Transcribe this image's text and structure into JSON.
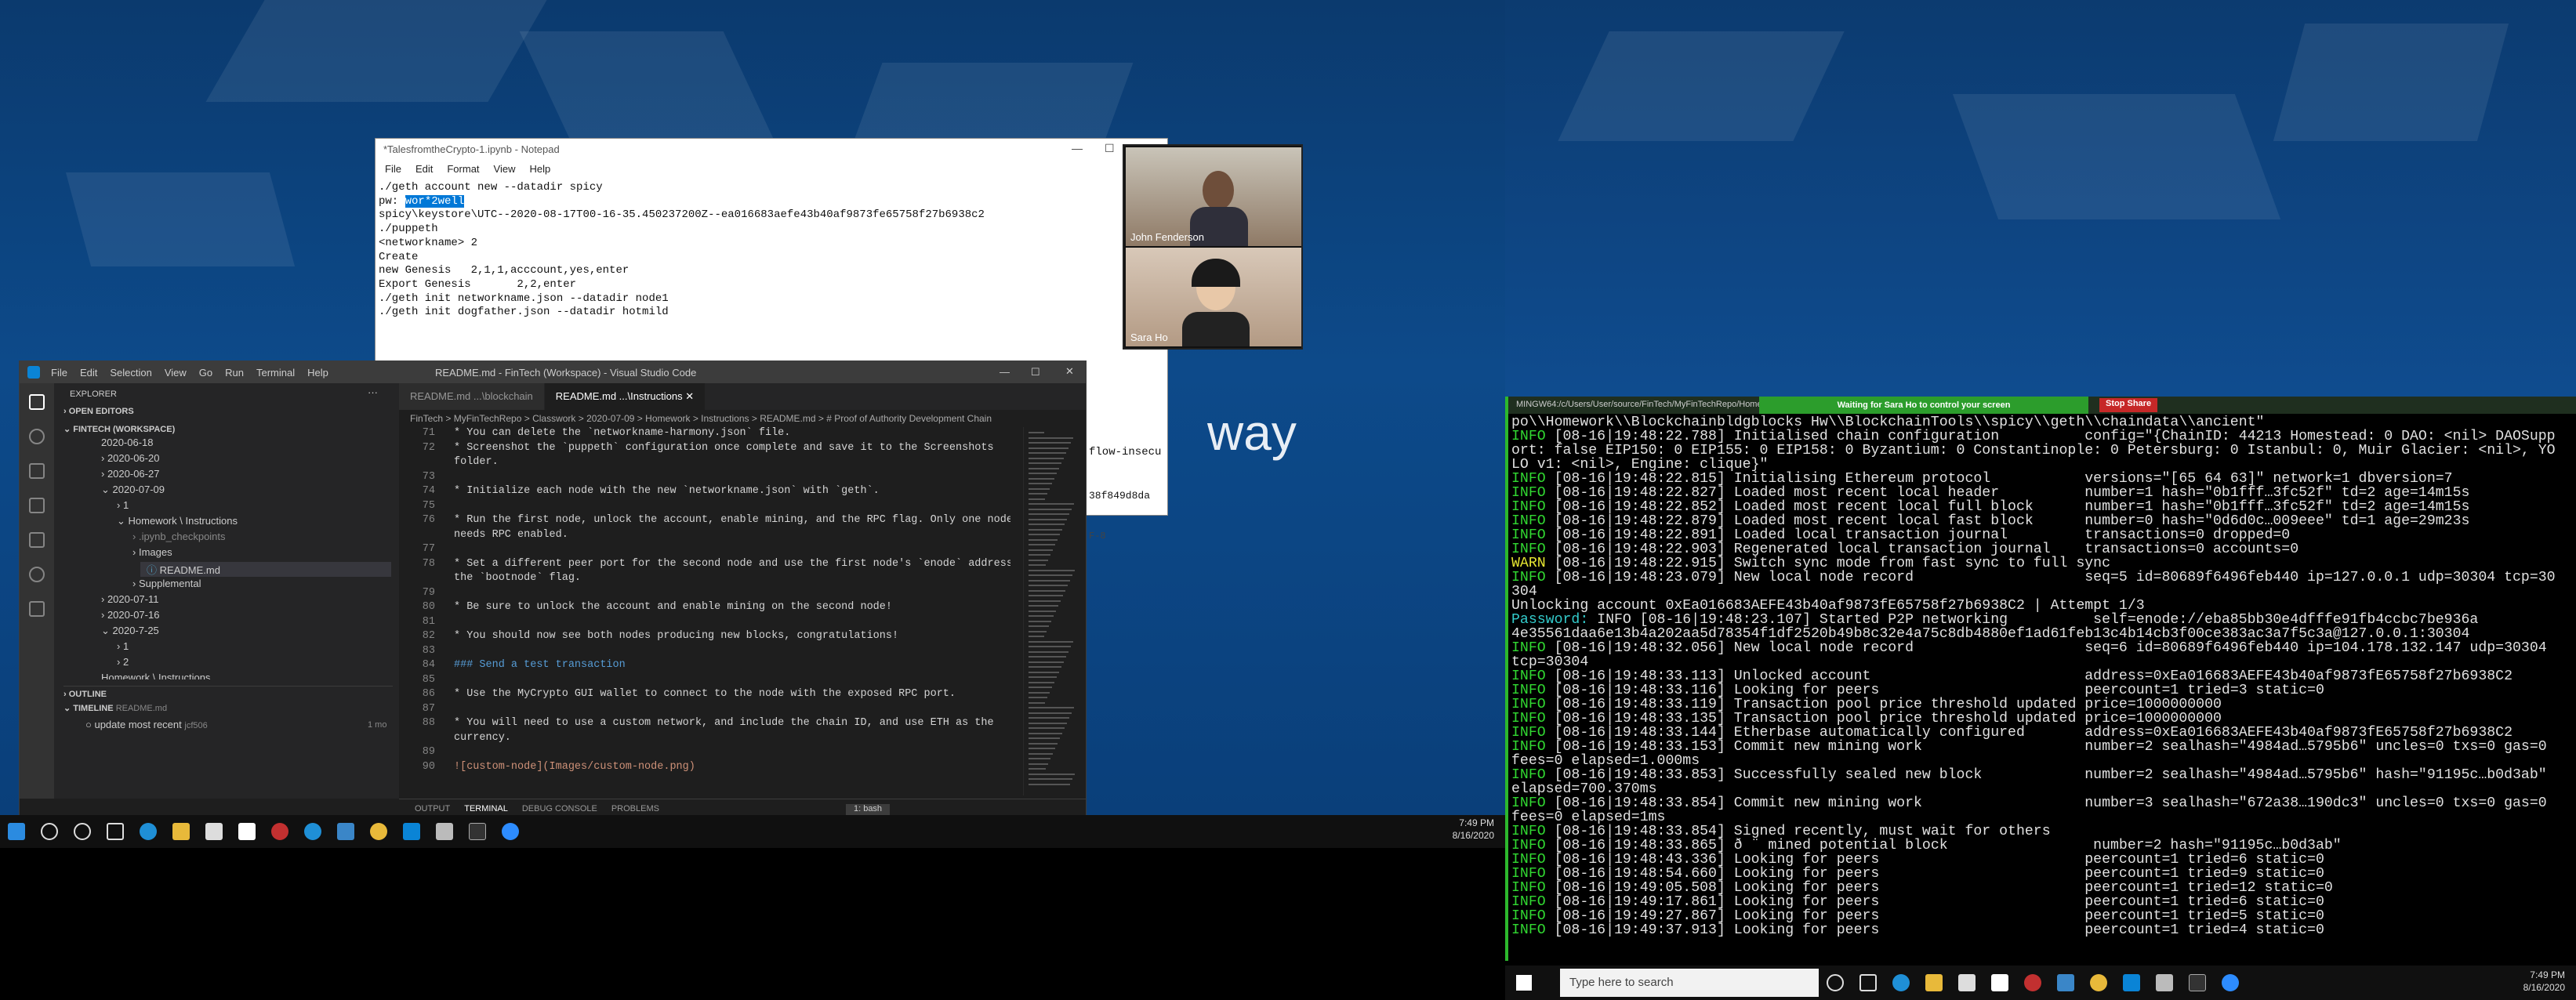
{
  "wallpaper_text": "way",
  "notepad": {
    "title": "*TalesfromtheCrypto-1.ipynb - Notepad",
    "menu": [
      "File",
      "Edit",
      "Format",
      "View",
      "Help"
    ],
    "lines": [
      "./geth account new --datadir spicy",
      "pw: ",
      "spicy\\keystore\\UTC--2020-08-17T00-16-35.450237200Z--ea016683aefe43b40af9873fe65758f27b6938c2",
      "./puppeth",
      "<networkname> 2",
      "Create",
      "new Genesis   2,1,1,acccount,yes,enter",
      "",
      "Export Genesis       2,2,enter",
      "",
      "./geth init networkname.json --datadir node1",
      "",
      "./geth init dogfather.json --datadir hotmild"
    ],
    "selected_pw": "wor*2well",
    "edge_text_1": "flow-insecu",
    "edge_text_2": "38f849d8da",
    "edge_text_3": "F-8"
  },
  "video": {
    "participant_1": "John Fenderson",
    "participant_2": "Sara Ho"
  },
  "vscode": {
    "title": "README.md - FinTech (Workspace) - Visual Studio Code",
    "menu": [
      "File",
      "Edit",
      "Selection",
      "View",
      "Go",
      "Run",
      "Terminal",
      "Help"
    ],
    "explorer_label": "EXPLORER",
    "open_editors": "OPEN EDITORS",
    "workspace": "FINTECH (WORKSPACE)",
    "tree": [
      "2020-06-18",
      "2020-06-20",
      "2020-06-27",
      "2020-07-09",
      "1",
      "Homework \\ Instructions",
      ".ipynb_checkpoints",
      "Images",
      "README.md",
      "Supplemental",
      "2020-07-11",
      "2020-07-16",
      "2020-7-25",
      "1",
      "2",
      "Homework \\ Instructions"
    ],
    "outline": "OUTLINE",
    "timeline": "TIMELINE",
    "timeline_file": "README.md",
    "timeline_item": "update most recent",
    "timeline_author": "jcf506",
    "timeline_age": "1 mo",
    "tabs": [
      "README.md ...\\blockchain",
      "README.md ...\\Instructions"
    ],
    "breadcrumb": "FinTech > MyFinTechRepo > Classwork > 2020-07-09 > Homework > Instructions > README.md > # Proof of Authority Development Chain",
    "lines": [
      {
        "n": "71",
        "t": "* You can delete the `networkname-harmony.json` file."
      },
      {
        "n": "72",
        "t": "* Screenshot the `puppeth` configuration once complete and save it to the Screenshots"
      },
      {
        "n": "",
        "t": "folder."
      },
      {
        "n": "73",
        "t": ""
      },
      {
        "n": "74",
        "t": "* Initialize each node with the new `networkname.json` with `geth`."
      },
      {
        "n": "75",
        "t": ""
      },
      {
        "n": "76",
        "t": "* Run the first node, unlock the account, enable mining, and the RPC flag. Only one node"
      },
      {
        "n": "",
        "t": "needs RPC enabled."
      },
      {
        "n": "77",
        "t": ""
      },
      {
        "n": "78",
        "t": "* Set a different peer port for the second node and use the first node's `enode` address as"
      },
      {
        "n": "",
        "t": "the `bootnode` flag."
      },
      {
        "n": "79",
        "t": ""
      },
      {
        "n": "80",
        "t": "* Be sure to unlock the account and enable mining on the second node!"
      },
      {
        "n": "81",
        "t": ""
      },
      {
        "n": "82",
        "t": "* You should now see both nodes producing new blocks, congratulations!"
      },
      {
        "n": "83",
        "t": ""
      },
      {
        "n": "84",
        "t": "### Send a test transaction"
      },
      {
        "n": "85",
        "t": ""
      },
      {
        "n": "86",
        "t": "* Use the MyCrypto GUI wallet to connect to the node with the exposed RPC port."
      },
      {
        "n": "87",
        "t": ""
      },
      {
        "n": "88",
        "t": "* You will need to use a custom network, and include the chain ID, and use ETH as the"
      },
      {
        "n": "",
        "t": "currency."
      },
      {
        "n": "89",
        "t": ""
      },
      {
        "n": "90",
        "t": "![custom-node](Images/custom-node.png)"
      }
    ],
    "panel_tabs": [
      "OUTPUT",
      "TERMINAL",
      "DEBUG CONSOLE",
      "PROBLEMS"
    ],
    "terminal_select": "1: bash"
  },
  "left_clock": {
    "time": "7:49 PM",
    "date": "8/16/2020"
  },
  "terminal": {
    "title": "MINGW64:/c/Users/User/source/FinTech/MyFinTechRepo/Homework/Blockchain",
    "share_banner": "Waiting for Sara Ho to control your screen",
    "stop_share": "Stop Share",
    "lines": [
      "po\\\\Homework\\\\Blockchainbldgblocks Hw\\\\BlockchainTools\\\\spicy\\\\geth\\\\chaindata\\\\ancient\"",
      "INFO [08-16|19:48:22.788] Initialised chain configuration          config=\"{ChainID: 44213 Homestead: 0 DAO: <nil> DAOSupp",
      "ort: false EIP150: 0 EIP155: 0 EIP158: 0 Byzantium: 0 Constantinople: 0 Petersburg: 0 Istanbul: 0, Muir Glacier: <nil>, YO",
      "LO v1: <nil>, Engine: clique}\"",
      "INFO [08-16|19:48:22.815] Initialising Ethereum protocol           versions=\"[65 64 63]\" network=1 dbversion=7",
      "INFO [08-16|19:48:22.827] Loaded most recent local header          number=1 hash=\"0b1fff…3fc52f\" td=2 age=14m15s",
      "INFO [08-16|19:48:22.852] Loaded most recent local full block      number=1 hash=\"0b1fff…3fc52f\" td=2 age=14m15s",
      "INFO [08-16|19:48:22.879] Loaded most recent local fast block      number=0 hash=\"0d6d0c…009eee\" td=1 age=29m23s",
      "INFO [08-16|19:48:22.891] Loaded local transaction journal         transactions=0 dropped=0",
      "INFO [08-16|19:48:22.903] Regenerated local transaction journal    transactions=0 accounts=0",
      "WARN [08-16|19:48:22.915] Switch sync mode from fast sync to full sync",
      "INFO [08-16|19:48:23.079] New local node record                    seq=5 id=80689f6496feb440 ip=127.0.0.1 udp=30304 tcp=30",
      "304",
      "Unlocking account 0xEa016683AEFE43b40af9873fE65758f27b6938C2 | Attempt 1/3",
      "Password: INFO [08-16|19:48:23.107] Started P2P networking          self=enode://eba85bb30e4dfffe91fb4ccbc7be936a",
      "4e35561daa6e13b4a202aa5d78354f1df2520b49b8c32e4a75c8db4880ef1ad61feb13c4b14cb3f00ce383ac3a7f5c3a@127.0.0.1:30304",
      "INFO [08-16|19:48:32.056] New local node record                    seq=6 id=80689f6496feb440 ip=104.178.132.147 udp=30304",
      "tcp=30304",
      "INFO [08-16|19:48:33.113] Unlocked account                         address=0xEa016683AEFE43b40af9873fE65758f27b6938C2",
      "INFO [08-16|19:48:33.116] Looking for peers                        peercount=1 tried=3 static=0",
      "INFO [08-16|19:48:33.119] Transaction pool price threshold updated price=1000000000",
      "INFO [08-16|19:48:33.135] Transaction pool price threshold updated price=1000000000",
      "INFO [08-16|19:48:33.144] Etherbase automatically configured       address=0xEa016683AEFE43b40af9873fE65758f27b6938C2",
      "INFO [08-16|19:48:33.153] Commit new mining work                   number=2 sealhash=\"4984ad…5795b6\" uncles=0 txs=0 gas=0",
      "fees=0 elapsed=1.000ms",
      "INFO [08-16|19:48:33.853] Successfully sealed new block            number=2 sealhash=\"4984ad…5795b6\" hash=\"91195c…b0d3ab\"",
      "elapsed=700.370ms",
      "INFO [08-16|19:48:33.854] Commit new mining work                   number=3 sealhash=\"672a38…190dc3\" uncles=0 txs=0 gas=0",
      "fees=0 elapsed=1ms",
      "INFO [08-16|19:48:33.854] Signed recently, must wait for others",
      "INFO [08-16|19:48:33.865] ð ¨ mined potential block                 number=2 hash=\"91195c…b0d3ab\"",
      "INFO [08-16|19:48:43.336] Looking for peers                        peercount=1 tried=6 static=0",
      "INFO [08-16|19:48:54.660] Looking for peers                        peercount=1 tried=9 static=0",
      "INFO [08-16|19:49:05.508] Looking for peers                        peercount=1 tried=12 static=0",
      "INFO [08-16|19:49:17.861] Looking for peers                        peercount=1 tried=6 static=0",
      "INFO [08-16|19:49:27.867] Looking for peers                        peercount=1 tried=5 static=0",
      "INFO [08-16|19:49:37.913] Looking for peers                        peercount=1 tried=4 static=0"
    ]
  },
  "search_placeholder": "Type here to search",
  "right_clock": {
    "time": "7:49 PM",
    "date": "8/16/2020"
  },
  "colors": {
    "accent": "#0078d7",
    "terminal_green": "#31d831",
    "share_green": "#2c9d2c",
    "stop_red": "#c62828"
  }
}
